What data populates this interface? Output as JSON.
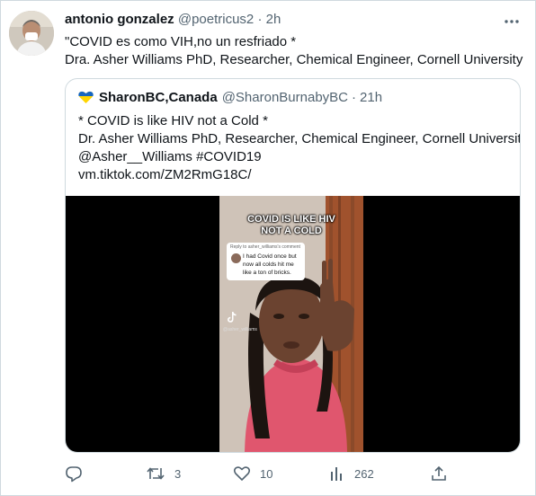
{
  "tweet": {
    "author_name": "antonio gonzalez",
    "author_handle": "@poetricus2",
    "separator": "·",
    "time": "2h",
    "text_line1": "\"COVID es como VIH,no un resfriado *",
    "text_line2": "Dra. Asher Williams PhD, Researcher, Chemical Engineer, Cornell University"
  },
  "quoted": {
    "author_name": "SharonBC,Canada",
    "author_handle": "@SharonBurnabyBC",
    "separator": "·",
    "time": "21h",
    "flag_icon": "blue-yellow-heart-icon",
    "text_line1": "* COVID is like HIV not a Cold *",
    "text_line2": "Dr. Asher Williams PhD, Researcher, Chemical Engineer, Cornell University",
    "text_line3": "@Asher__Williams #COVID19",
    "text_line4": "vm.tiktok.com/ZM2RmG18C/",
    "video": {
      "overlay_title_line1": "COVID IS LIKE HIV",
      "overlay_title_line2": "NOT A COLD",
      "reply_meta": "Reply to asher_williams's comment",
      "reply_text": "I had Covid once but now all colds hit me like a ton of bricks.",
      "tiktok_handle": "@asher_williams"
    }
  },
  "actions": {
    "reply_count": "",
    "retweet_count": "3",
    "like_count": "10",
    "views_count": "262"
  },
  "colors": {
    "text": "#0f1419",
    "muted": "#536471",
    "border": "#cfd9de",
    "video_bg": "#000000",
    "shirt": "#e0566e"
  }
}
